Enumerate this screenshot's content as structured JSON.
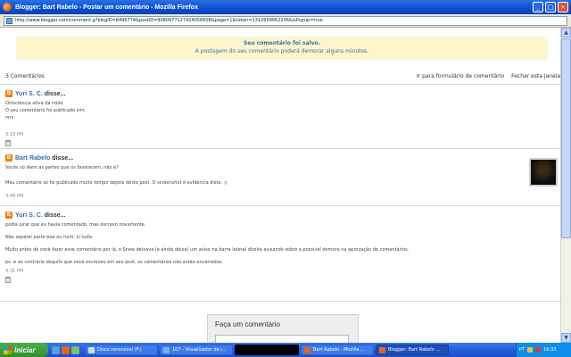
{
  "window": {
    "title": "Blogger: Bart Rabelo - Postar um comentário - Mozilla Firefox",
    "buttons": {
      "minimize": "_",
      "maximize": "□",
      "close": "×"
    }
  },
  "urlbar": {
    "url": "http://www.blogger.com/comment.g?blogID=8496774&postID=9080977127424056608&page=1&token=1312659062236&isPopup=true"
  },
  "notice": {
    "title": "Seu comentário foi salvo.",
    "message": "A postagem do seu comentário poderá demorar alguns minutos."
  },
  "comments_header": {
    "count": "3 Comentários",
    "link_form": "Ir para formulário de comentário",
    "link_close": "Fechar esta janela"
  },
  "comments": [
    {
      "author": "Yuri S. C.",
      "said": "disse...",
      "lines": [
        "Onisciência ativa da nóóó.",
        "O seu comentário foi publicado sim.",
        "rsrs"
      ],
      "time": "3:33 PM"
    },
    {
      "author": "Bart Rabelo",
      "said": "disse...",
      "lines": [
        "Vocês só lêem as partes que os favorecem, não é?",
        "Meu comentário só foi publicado muito tempo depois deste post. O screenshot é evidência disto. ;)"
      ],
      "time": "3:48 PM"
    },
    {
      "author": "Yuri S. C.",
      "said": "disse...",
      "lines": [
        "podia jurar que eu havia comentado, mas escrevo novamente.",
        "Não separei parte boa ou ruim. Li tudo.",
        "Muito antes de você fazer esse comentário por lá, o Snow deixava (e ainda deixa) um aviso na barra lateral direita avisando sobre a possível demora na aprovação de comentários.",
        "ps: e ao contrário daquilo que você escreveu em seu post, os comentários não estão encerrados."
      ],
      "time": "4:31 PM"
    }
  ],
  "comment_form": {
    "title": "Faça um comentário"
  },
  "taskbar": {
    "start": "Iniciar",
    "tasks": [
      {
        "label": "Disco removível (F:)",
        "icon_color": "#d9d9d9"
      },
      {
        "label": "107 - Visualizador de i...",
        "icon_color": "#7bb0e8"
      },
      {
        "label": "",
        "icon_color": "#000000"
      },
      {
        "label": "Bart Rabelo - Mozilla ...",
        "icon_color": "#e8641a"
      },
      {
        "label": "Blogger: Bart Rabelo ...",
        "icon_color": "#e8641a"
      }
    ],
    "tray": {
      "lang": "PT",
      "clock": "16:33"
    }
  },
  "colors": {
    "accent": "#3a6ea5",
    "notice_bg": "#fbf6cc",
    "blogger_orange": "#f57d00"
  }
}
